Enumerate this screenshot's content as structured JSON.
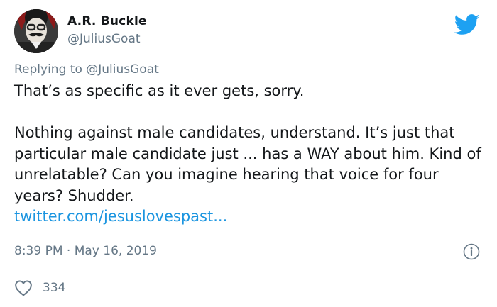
{
  "author": {
    "name": "A.R. Buckle",
    "handle": "@JuliusGoat"
  },
  "reply": {
    "prefix": "Replying to",
    "mention": "@JuliusGoat"
  },
  "tweet": {
    "text": "That’s as specific as it ever gets, sorry.\n\nNothing against male candidates, understand. It’s just that particular male candidate just ... has a WAY about him. Kind of unrelatable? Can you imagine hearing that voice for four years? Shudder.",
    "link": "twitter.com/jesuslovespast..."
  },
  "meta": {
    "timestamp": "8:39 PM · May 16, 2019"
  },
  "engagement": {
    "likes": "334"
  },
  "icons": {
    "brand": "twitter-bird-icon",
    "info": "info-icon",
    "like": "heart-icon"
  },
  "colors": {
    "brand": "#1da1f2",
    "link": "#1b95e0",
    "secondary_text": "#657786",
    "divider": "#e1e8ed"
  }
}
